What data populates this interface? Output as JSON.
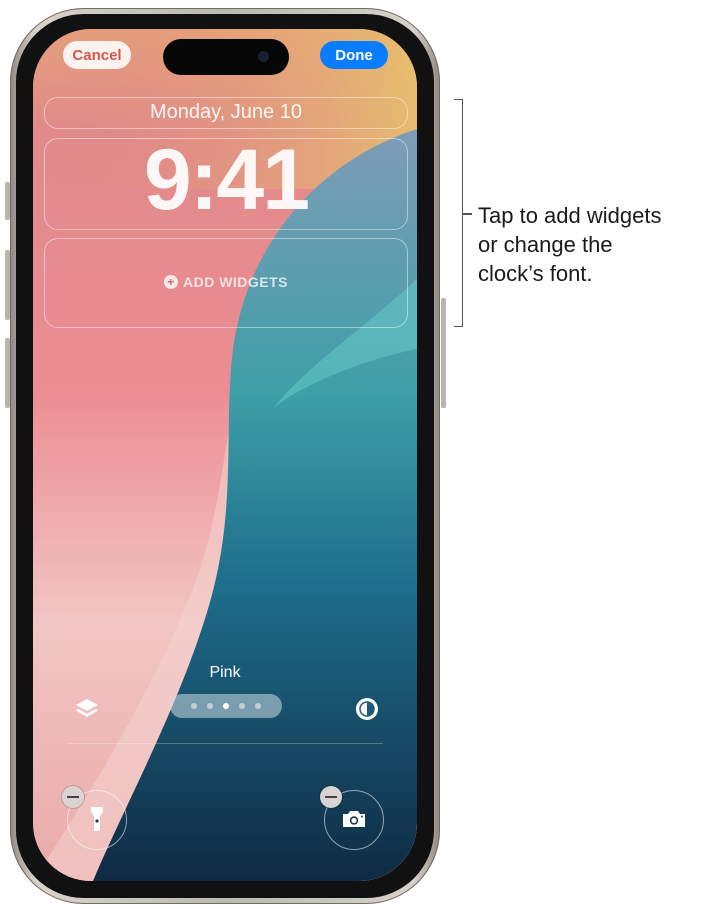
{
  "lock_screen": {
    "cancel_label": "Cancel",
    "done_label": "Done",
    "date": "Monday, June 10",
    "time": "9:41",
    "add_widgets_label": "ADD WIDGETS",
    "style_name": "Pink",
    "style_page_count": 5,
    "style_page_selected": 3
  },
  "icons": {
    "style_gallery": "layers-icon",
    "color_filter": "contrast-icon",
    "left_shortcut": "flashlight-icon",
    "right_shortcut": "camera-icon",
    "remove_shortcut": "minus-icon"
  },
  "colors": {
    "done_button": "#0a7cff",
    "cancel_text": "#d9534f",
    "wallpaper_pink": "#e98d96",
    "wallpaper_teal": "#2b8fa0",
    "wallpaper_navy": "#123a55"
  },
  "callout": {
    "lines": [
      "Tap to add widgets",
      "or change the",
      "clock’s font."
    ]
  }
}
